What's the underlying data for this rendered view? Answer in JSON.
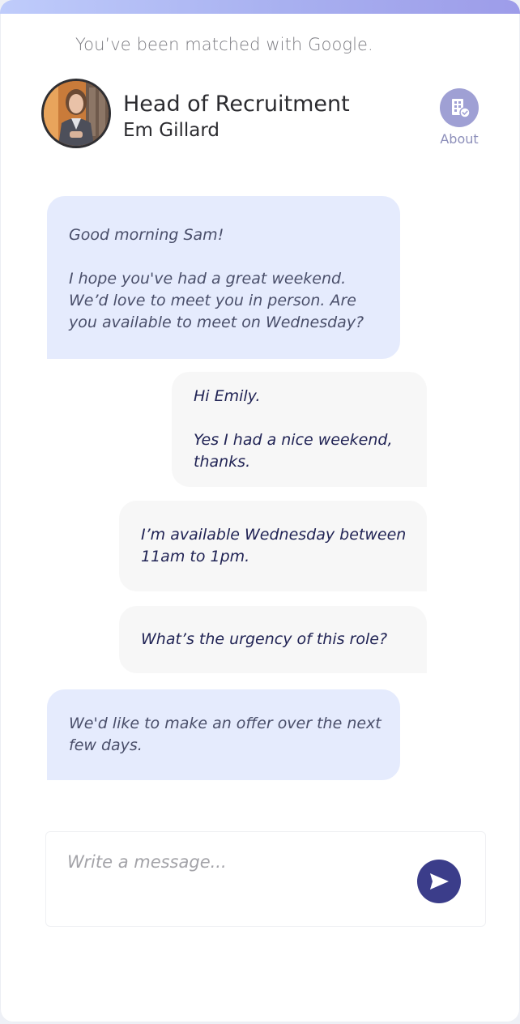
{
  "header": {
    "match_text": "You’ve been matched with Google.",
    "contact_title": "Head of Recruitment",
    "contact_name": "Em Gillard",
    "about_label": "About",
    "icons": {
      "avatar": "profile-photo",
      "about": "building-check-icon"
    }
  },
  "messages": [
    {
      "direction": "incoming",
      "text": "Good morning Sam!\n\nI hope you've had a great weekend.\nWe’d love to meet you in person. Are you available to meet on Wednesday?"
    },
    {
      "direction": "outgoing",
      "text": "Hi Emily.\n\nYes I had a nice weekend, thanks."
    },
    {
      "direction": "outgoing",
      "text": "I’m available Wednesday between 11am to 1pm."
    },
    {
      "direction": "outgoing",
      "text": "What’s the urgency of this role?"
    },
    {
      "direction": "incoming",
      "text": "We'd like to make an offer over the next few days."
    }
  ],
  "composer": {
    "placeholder": "Write a message...",
    "value": "",
    "send_icon": "paper-plane-icon"
  },
  "colors": {
    "accent": "#3b3d8a",
    "incoming_bubble": "#e5ebfd",
    "outgoing_bubble": "#f7f7f7",
    "about_icon_bg": "#9fa0d4",
    "top_gradient_start": "#bfccfb",
    "top_gradient_end": "#9d9ce9"
  }
}
